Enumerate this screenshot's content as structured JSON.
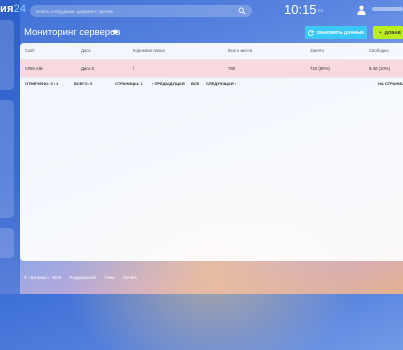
{
  "brand": {
    "name": "ия",
    "num": "24"
  },
  "search": {
    "placeholder": "искать сотрудника, документ, прочее..."
  },
  "clock": {
    "time": "10:15",
    "suffix": "P4"
  },
  "page": {
    "title": "Мониторинг серверов",
    "refresh_label": "ОБНОВИТЬ ДАННЫЕ",
    "add_label": "ДОБАВ"
  },
  "grid": {
    "columns": [
      "Сайт",
      "Диск",
      "Корневая папка",
      "Всего места",
      "Занято",
      "Свободно"
    ],
    "rows": [
      {
        "site": "CRM Alle",
        "disk": "Диск S",
        "root": "/",
        "total": "790",
        "used": "710 (90%)",
        "free": "9.40 (10%)"
      }
    ]
  },
  "footer": {
    "selected_label": "ОТМЕЧЕНО:",
    "selected_value": "0 / 1",
    "total_label": "ВСЕГО:",
    "total_value": "0",
    "pages_label": "СТРАНИЦЫ:",
    "pages_value": "1",
    "prev": "ПРЕДЫДУЩАЯ",
    "all": "ВСЕ",
    "next": "СЛЕДУЮЩАЯ",
    "per_page": "НА СТРАНИЦ"
  },
  "bottom": {
    "copyright": "© «Битрикс», 2023",
    "support": "Поддержка24",
    "themes": "Темы",
    "print": "Печать"
  },
  "colors": {
    "refresh": "#3bc8f5",
    "add": "#bbed21",
    "row_selected": "#f8d9dd"
  }
}
